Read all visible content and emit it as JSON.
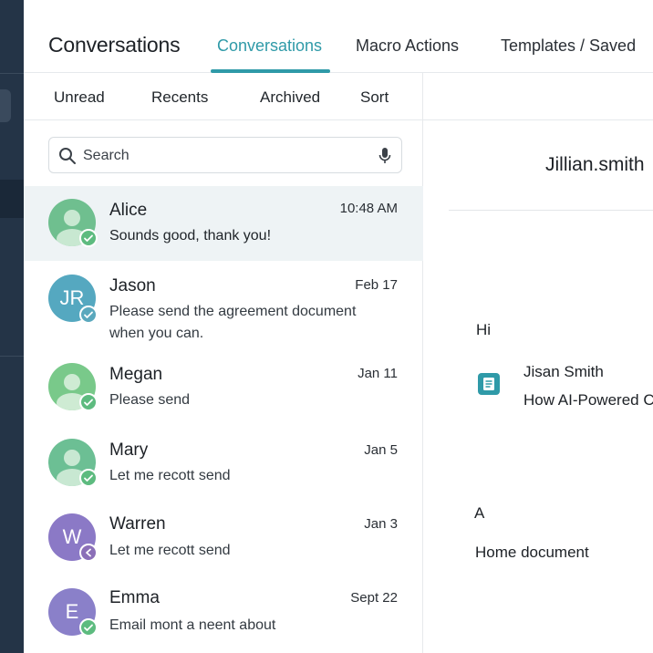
{
  "header": {
    "title": "Conversations",
    "tabs": [
      {
        "label": "Conversations",
        "active": true
      },
      {
        "label": "Macro Actions",
        "active": false
      },
      {
        "label": "Templates / Saved",
        "active": false
      }
    ]
  },
  "list": {
    "filters": [
      "Unread",
      "Recents",
      "Archived",
      "Sort"
    ],
    "search_placeholder": "Search",
    "conversations": [
      {
        "name": "Alice",
        "time": "10:48 AM",
        "preview": "Sounds good, thank you!",
        "avatar": "person-icon",
        "avatar_color": "#6fbf8f",
        "badge": "check-icon",
        "badge_color": "#5dbb7f",
        "selected": true
      },
      {
        "name": "Jason",
        "initials": "JR",
        "time": "Feb 17",
        "preview": "Please send the agreement document when you can.",
        "avatar_color": "#55a8c0",
        "badge": "check-icon",
        "badge_color": "#5aa8bd"
      },
      {
        "name": "Megan",
        "time": "Jan 11",
        "preview": "Please send",
        "avatar": "person-icon",
        "avatar_color": "#79c98a",
        "badge": "check-icon",
        "badge_color": "#5dbb7f"
      },
      {
        "name": "Mary",
        "time": "Jan 5",
        "preview": "Let me recott send",
        "avatar": "person-icon",
        "avatar_color": "#6cbf94",
        "badge": "check-icon",
        "badge_color": "#5dbb7f"
      },
      {
        "name": "Warren",
        "initials": "W",
        "time": "Jan  3",
        "preview": "Let me recott send",
        "avatar_color": "#8b79c6",
        "badge": "reply-icon",
        "badge_color": "#8b6fb8"
      },
      {
        "name": "Emma",
        "initials": "E",
        "time": "Sept 22",
        "preview": "Email mont a neent about",
        "avatar_color": "#8a80c9",
        "badge": "check-icon",
        "badge_color": "#5dbb7f"
      }
    ]
  },
  "detail": {
    "user": "Jillian.smith",
    "greeting": "Hi",
    "sender": "Jisan Smith",
    "subject": "How AI-Powered C",
    "letter": "A",
    "footer_text": "Home document"
  },
  "colors": {
    "accent": "#2f9aa8",
    "rail": "#243447"
  }
}
